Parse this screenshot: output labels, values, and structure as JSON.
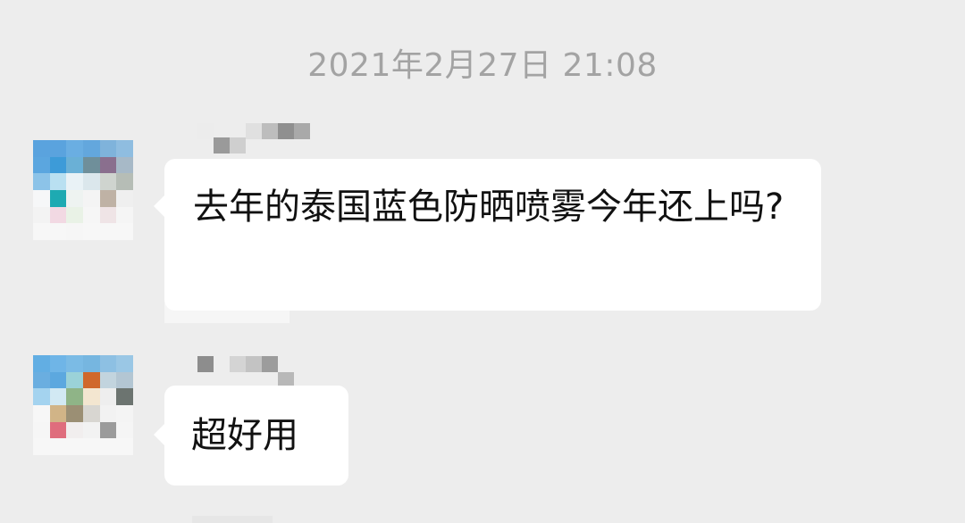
{
  "timestamp": "2021年2月27日 21:08",
  "messages": [
    {
      "text": "去年的泰国蓝色防晒喷雾今年还上吗?",
      "avatar_icon": "pixelated-avatar-icon",
      "sender_icon": "pixelated-name-icon"
    },
    {
      "text": "超好用",
      "avatar_icon": "pixelated-avatar-icon",
      "sender_icon": "pixelated-name-icon"
    }
  ],
  "colors": {
    "background": "#ededed",
    "bubble": "#ffffff",
    "timestamp": "#a3a3a3",
    "text": "#111111"
  }
}
